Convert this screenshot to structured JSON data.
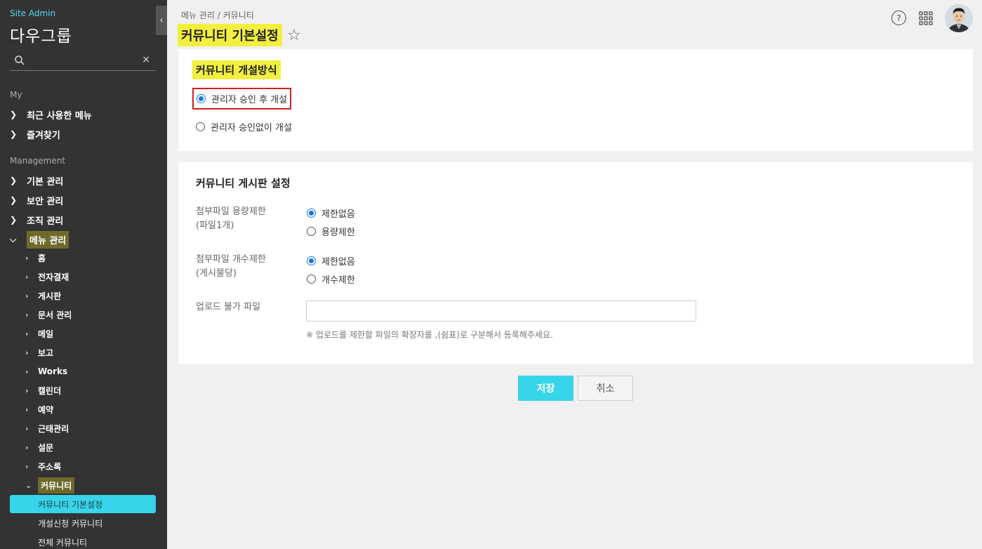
{
  "sidebar": {
    "brand_top": "Site Admin",
    "brand_name": "다우그룹",
    "search_placeholder": "",
    "clear_symbol": "×",
    "collapse_symbol": "‹",
    "sections": {
      "my_label": "My",
      "management_label": "Management"
    },
    "my_items": [
      {
        "label": "최근 사용한 메뉴"
      },
      {
        "label": "즐겨찾기"
      }
    ],
    "management_items": [
      {
        "label": "기본 관리"
      },
      {
        "label": "보안 관리"
      },
      {
        "label": "조직 관리"
      },
      {
        "label": "메뉴 관리"
      }
    ],
    "menu_sub_items": [
      {
        "label": "홈"
      },
      {
        "label": "전자결재"
      },
      {
        "label": "게시판"
      },
      {
        "label": "문서 관리"
      },
      {
        "label": "메일"
      },
      {
        "label": "보고"
      },
      {
        "label": "Works"
      },
      {
        "label": "캘린더"
      },
      {
        "label": "예약"
      },
      {
        "label": "근태관리"
      },
      {
        "label": "설문"
      },
      {
        "label": "주소록"
      },
      {
        "label": "커뮤니티"
      }
    ],
    "community_leaves": [
      {
        "label": "커뮤니티 기본설정",
        "active": true
      },
      {
        "label": "개설신청 커뮤니티"
      },
      {
        "label": "전체 커뮤니티"
      }
    ]
  },
  "header": {
    "breadcrumb": "메뉴 관리 / 커뮤니티",
    "title": "커뮤니티 기본설정",
    "help_symbol": "?"
  },
  "panel1": {
    "heading": "커뮤니티 개설방식",
    "options": [
      {
        "label": "관리자 승인 후 개설",
        "selected": true
      },
      {
        "label": "관리자 승인없이 개설",
        "selected": false
      }
    ]
  },
  "panel2": {
    "heading": "커뮤니티 게시판 설정",
    "size_limit": {
      "label_line1": "첨부파일 용량제한",
      "label_line2": "(파일1개)",
      "options": [
        {
          "label": "제한없음",
          "selected": true
        },
        {
          "label": "용량제한",
          "selected": false
        }
      ]
    },
    "count_limit": {
      "label_line1": "첨부파일 개수제한",
      "label_line2": "(게시물당)",
      "options": [
        {
          "label": "제한없음",
          "selected": true
        },
        {
          "label": "개수제한",
          "selected": false
        }
      ]
    },
    "blocked_files": {
      "label": "업로드 불가 파일",
      "value": "",
      "hint": "※ 업로드를 제한할 파일의 확장자를 ,(쉼표)로 구분해서 등록해주세요."
    }
  },
  "actions": {
    "save": "저장",
    "cancel": "취소"
  },
  "colors": {
    "sidebar_bg": "#333333",
    "accent": "#38d4ea",
    "highlight": "#f3ef3f",
    "radio_on": "#1a73e8"
  }
}
